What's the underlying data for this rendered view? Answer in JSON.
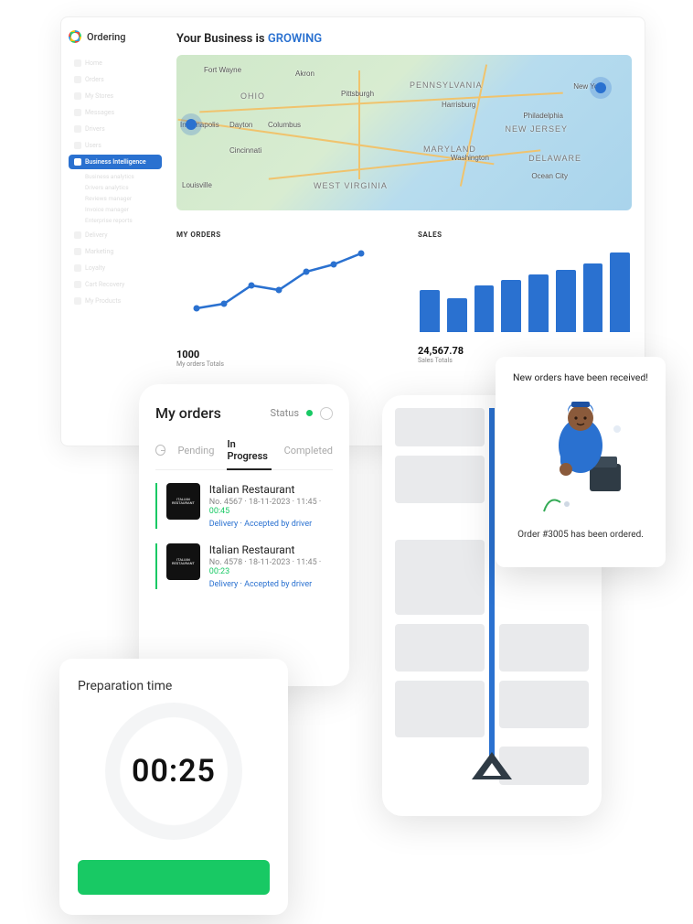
{
  "brand": {
    "name": "Ordering"
  },
  "headline": {
    "prefix": "Your Business is ",
    "highlight": "GROWING"
  },
  "sidebar": {
    "items": [
      {
        "label": "Home"
      },
      {
        "label": "Orders"
      },
      {
        "label": "My Stores"
      },
      {
        "label": "Messages"
      },
      {
        "label": "Drivers"
      },
      {
        "label": "Users"
      }
    ],
    "active": {
      "label": "Business Intelligence"
    },
    "subitems": [
      {
        "label": "Business analytics"
      },
      {
        "label": "Drivers analytics"
      },
      {
        "label": "Reviews manager"
      },
      {
        "label": "Invoice manager"
      },
      {
        "label": "Enterprise reports"
      }
    ],
    "items_after": [
      {
        "label": "Delivery"
      },
      {
        "label": "Marketing"
      },
      {
        "label": "Loyalty"
      },
      {
        "label": "Cart Recovery"
      },
      {
        "label": "My Products"
      }
    ]
  },
  "map": {
    "labels": {
      "ohio": "OHIO",
      "pennsylvania": "PENNSYLVANIA",
      "west_virginia": "WEST VIRGINIA",
      "maryland": "MARYLAND",
      "new_jersey": "NEW JERSEY",
      "delaware": "DELAWARE",
      "fort_wayne": "Fort Wayne",
      "akron": "Akron",
      "pittsburgh": "Pittsburgh",
      "harrisburg": "Harrisburg",
      "new_york": "New York",
      "philadelphia": "Philadelphia",
      "indianapolis": "Indianapolis",
      "dayton": "Dayton",
      "columbus": "Columbus",
      "cincinnati": "Cincinnati",
      "washington": "Washington",
      "ocean_city": "Ocean City",
      "louisville": "Louisville"
    }
  },
  "charts": {
    "orders": {
      "title": "MY ORDERS",
      "total": "1000",
      "total_label": "My orders Totals"
    },
    "sales": {
      "title": "SALES",
      "total": "24,567.78",
      "total_label": "Sales Totals"
    }
  },
  "chart_data": [
    {
      "type": "line",
      "title": "MY ORDERS",
      "x": [
        0,
        1,
        2,
        3,
        4,
        5,
        6
      ],
      "values": [
        30,
        35,
        55,
        50,
        70,
        78,
        90
      ],
      "ylim": [
        0,
        100
      ]
    },
    {
      "type": "bar",
      "title": "SALES",
      "categories": [
        "",
        "",
        "",
        "",
        "",
        "",
        "",
        ""
      ],
      "values": [
        50,
        40,
        55,
        62,
        68,
        74,
        82,
        95
      ],
      "ylim": [
        0,
        100
      ]
    }
  ],
  "orders_card": {
    "title": "My orders",
    "status_label": "Status",
    "tabs": {
      "pending": "Pending",
      "in_progress": "In Progress",
      "completed": "Completed"
    },
    "items": [
      {
        "name": "Italian Restaurant",
        "meta": "No. 4567 · 18-11-2023 · 11:45 · ",
        "eta": "00:45",
        "delivery": "Delivery · Accepted by driver",
        "thumb": "ITALIAN RESTAURANT"
      },
      {
        "name": "Italian Restaurant",
        "meta": "No. 4578 · 18-11-2023 · 11:45 · ",
        "eta": "00:23",
        "delivery": "Delivery · Accepted by driver",
        "thumb": "ITALIAN RESTAURANT"
      }
    ]
  },
  "prep": {
    "title": "Preparation time",
    "time": "00:25"
  },
  "notif": {
    "title": "New orders have been received!",
    "sub": "Order #3005 has been ordered."
  }
}
